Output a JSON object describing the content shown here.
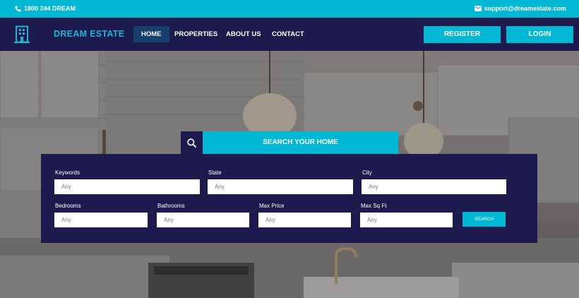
{
  "topbar": {
    "phone": "1800 244 DREAM",
    "email": "support@dreamestate.com",
    "phone_icon": "phone-icon",
    "email_icon": "envelope-icon"
  },
  "nav": {
    "brand": "DREAM ESTATE",
    "logo_icon": "building-icon",
    "items": [
      "HOME",
      "PROPERTIES",
      "ABOUT US",
      "CONTACT"
    ],
    "active_item": "HOME",
    "register": "REGISTER",
    "login": "LOGIN"
  },
  "search": {
    "tab_title": "SEARCH YOUR HOME",
    "tab_icon": "search-icon",
    "fields": [
      {
        "label": "Keywords",
        "placeholder": "Any"
      },
      {
        "label": "State",
        "placeholder": "Any"
      },
      {
        "label": "City",
        "placeholder": "Any"
      },
      {
        "label": "Bedrooms",
        "placeholder": "Any"
      },
      {
        "label": "Bathrooms",
        "placeholder": "Any"
      },
      {
        "label": "Max Price",
        "placeholder": "Any"
      },
      {
        "label": "Max Sq Ft",
        "placeholder": "Any"
      }
    ],
    "button": "SEARCH"
  },
  "colors": {
    "accent": "#00b8d4",
    "navy": "#1d1a4e",
    "nav_active": "#163f6d"
  }
}
